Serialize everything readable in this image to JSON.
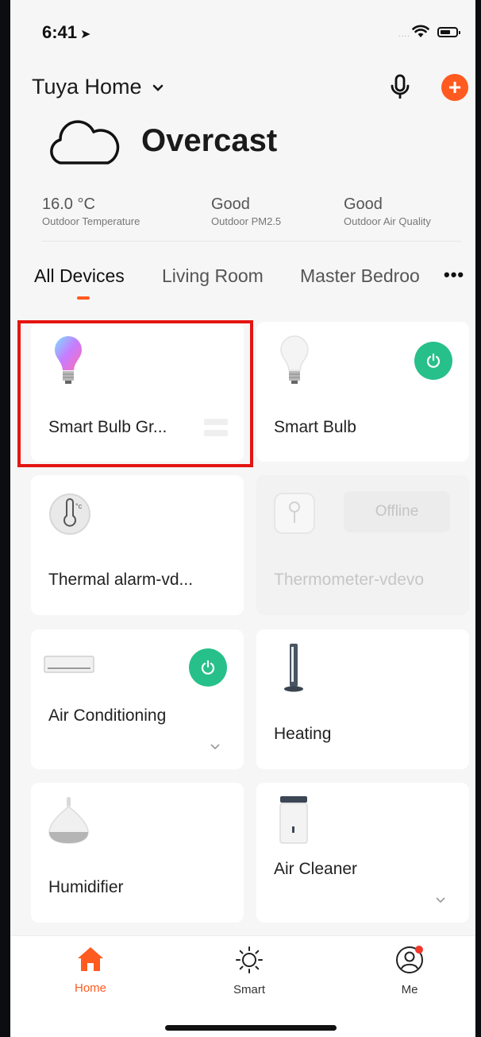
{
  "status_bar": {
    "time": "6:41",
    "location_arrow": "location-arrow-icon",
    "signal": "....",
    "wifi": "wifi-icon",
    "battery": "battery-icon"
  },
  "header": {
    "home_name": "Tuya Home",
    "mic_icon": "mic-icon",
    "add_icon": "plus-icon"
  },
  "weather": {
    "condition": "Overcast",
    "icon": "cloud-icon",
    "stats": [
      {
        "value": "16.0 °C",
        "label": "Outdoor Temperature"
      },
      {
        "value": "Good",
        "label": "Outdoor PM2.5"
      },
      {
        "value": "Good",
        "label": "Outdoor Air Quality"
      }
    ]
  },
  "tabs": {
    "items": [
      "All Devices",
      "Living Room",
      "Master Bedroo"
    ],
    "active_index": 0,
    "more": "•••"
  },
  "devices": [
    {
      "name": "Smart Bulb Gr...",
      "icon": "rgb-bulb-icon",
      "control": "group-icon",
      "highlighted": true
    },
    {
      "name": "Smart Bulb",
      "icon": "bulb-icon",
      "control": "power-icon",
      "power_on": true
    },
    {
      "name": "Thermal alarm-vd...",
      "icon": "thermometer-icon"
    },
    {
      "name": "Thermometer-vdevo",
      "icon": "thermometer-sensor-icon",
      "status": "Offline",
      "offline": true
    },
    {
      "name": "Air Conditioning",
      "icon": "air-conditioner-icon",
      "control": "power-icon",
      "power_on": true,
      "expand": "chevron-down-icon"
    },
    {
      "name": "Heating",
      "icon": "tower-heater-icon"
    },
    {
      "name": "Humidifier",
      "icon": "humidifier-icon"
    },
    {
      "name": "Air Cleaner",
      "icon": "air-purifier-icon",
      "expand": "chevron-down-icon"
    }
  ],
  "bottom_nav": [
    {
      "label": "Home",
      "icon": "home-icon",
      "active": true
    },
    {
      "label": "Smart",
      "icon": "sun-icon"
    },
    {
      "label": "Me",
      "icon": "profile-icon",
      "badge": true
    }
  ],
  "colors": {
    "accent": "#ff5a1f",
    "power_green": "#27c08a",
    "highlight_red": "#e41512",
    "background": "#f6f6f6"
  }
}
